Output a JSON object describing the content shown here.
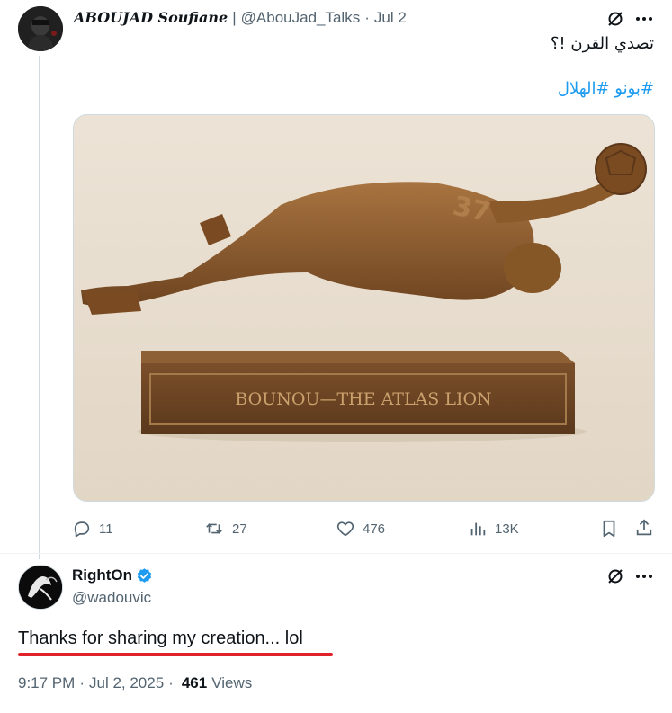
{
  "tweet1": {
    "display_name": "ABOUJAD Soufiane",
    "separator": "|",
    "handle": "@AbouJad_Talks",
    "date": "Jul 2",
    "text": "تصدي القرن !؟",
    "hashtags": "#بونو #الهلال",
    "media": {
      "plaque_text": "BOUNOU—THE ATLAS LION",
      "background": "#e9dfd0",
      "bronze": "#8a5a2b"
    },
    "actions": {
      "replies": "11",
      "retweets": "27",
      "likes": "476",
      "views": "13K"
    }
  },
  "tweet2": {
    "display_name": "RightOn",
    "handle": "@wadouvic",
    "text": "Thanks for sharing my creation... lol",
    "time": "9:17 PM",
    "date": "Jul 2, 2025",
    "views_count": "461",
    "views_label": "Views"
  },
  "colors": {
    "accent": "#1d9bf0",
    "secondary_text": "#536471",
    "underline": "#e0222a",
    "verified": "#1d9bf0"
  },
  "icons": [
    "grok-icon",
    "more-icon",
    "reply-icon",
    "retweet-icon",
    "like-icon",
    "views-icon",
    "bookmark-icon",
    "share-icon",
    "verified-badge-icon"
  ]
}
